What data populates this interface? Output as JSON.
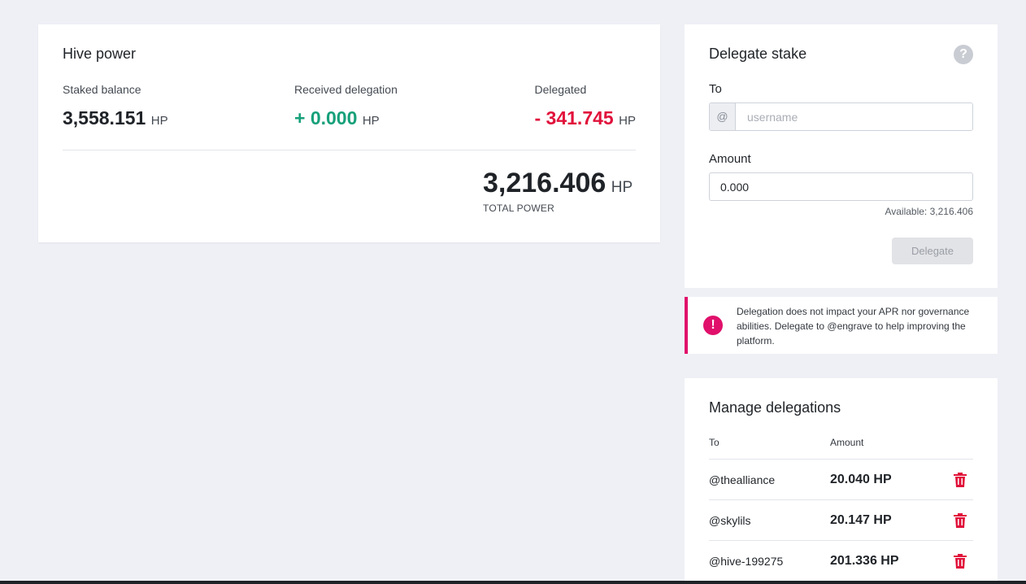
{
  "hive_power": {
    "title": "Hive power",
    "staked": {
      "label": "Staked balance",
      "value": "3,558.151",
      "unit": "HP"
    },
    "received": {
      "label": "Received delegation",
      "value": "+ 0.000",
      "unit": "HP"
    },
    "delegated": {
      "label": "Delegated",
      "value": "- 341.745",
      "unit": "HP"
    },
    "total": {
      "value": "3,216.406",
      "unit": "HP",
      "label": "TOTAL POWER"
    }
  },
  "delegate_stake": {
    "title": "Delegate stake",
    "help_icon": "question-mark-icon",
    "to_label": "To",
    "to_prefix": "@",
    "to_placeholder": "username",
    "amount_label": "Amount",
    "amount_value": "0.000",
    "available": "Available: 3,216.406",
    "button_label": "Delegate"
  },
  "note": {
    "icon": "exclamation-icon",
    "text": "Delegation does not impact your APR nor governance abilities. Delegate to @engrave to help improving the platform."
  },
  "manage_delegations": {
    "title": "Manage delegations",
    "headers": {
      "to": "To",
      "amount": "Amount"
    },
    "rows": [
      {
        "user": "@thealliance",
        "amount": "20.040 HP"
      },
      {
        "user": "@skylils",
        "amount": "20.147 HP"
      },
      {
        "user": "@hive-199275",
        "amount": "201.336 HP"
      }
    ],
    "row_icon": "trash-icon"
  },
  "colors": {
    "background": "#eff0f6",
    "positive": "#17a07a",
    "negative": "#e1123b",
    "accent": "#e0106b"
  }
}
